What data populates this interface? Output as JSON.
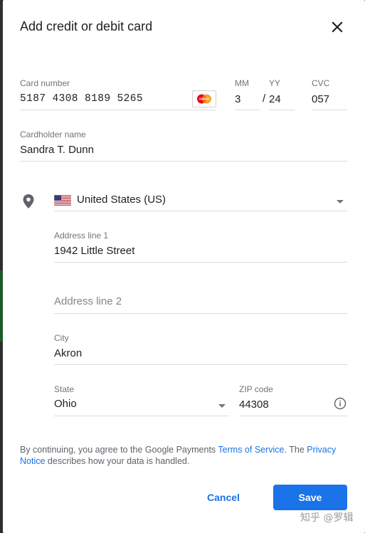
{
  "dialog": {
    "title": "Add credit or debit card",
    "close_icon": "close-icon"
  },
  "card": {
    "number_label": "Card number",
    "number": "5187 4308 8189 5265",
    "brand_icon": "mastercard-icon",
    "mm_label": "MM",
    "mm": "3",
    "yy_label": "YY",
    "separator": "/",
    "yy": "24",
    "cvc_label": "CVC",
    "cvc": "057"
  },
  "cardholder": {
    "label": "Cardholder name",
    "value": "Sandra T. Dunn"
  },
  "address": {
    "location_icon": "location-pin-icon",
    "country_flag_icon": "us-flag-icon",
    "country": "United States (US)",
    "line1_label": "Address line 1",
    "line1": "1942 Little Street",
    "line2_placeholder": "Address line 2",
    "city_label": "City",
    "city": "Akron",
    "state_label": "State",
    "state": "Ohio",
    "zip_label": "ZIP code",
    "zip": "44308",
    "info_icon": "info-icon"
  },
  "notice": {
    "before": "By continuing, you agree to the Google Payments ",
    "terms_link": "Terms of Service",
    "middle": ". The ",
    "privacy_link": "Privacy Notice",
    "after": " describes how your data is handled."
  },
  "buttons": {
    "cancel": "Cancel",
    "save": "Save"
  },
  "watermark": "知乎 @罗辑",
  "colors": {
    "accent": "#1a73e8",
    "label": "#70757a",
    "text": "#202124",
    "divider": "#dadce0"
  }
}
